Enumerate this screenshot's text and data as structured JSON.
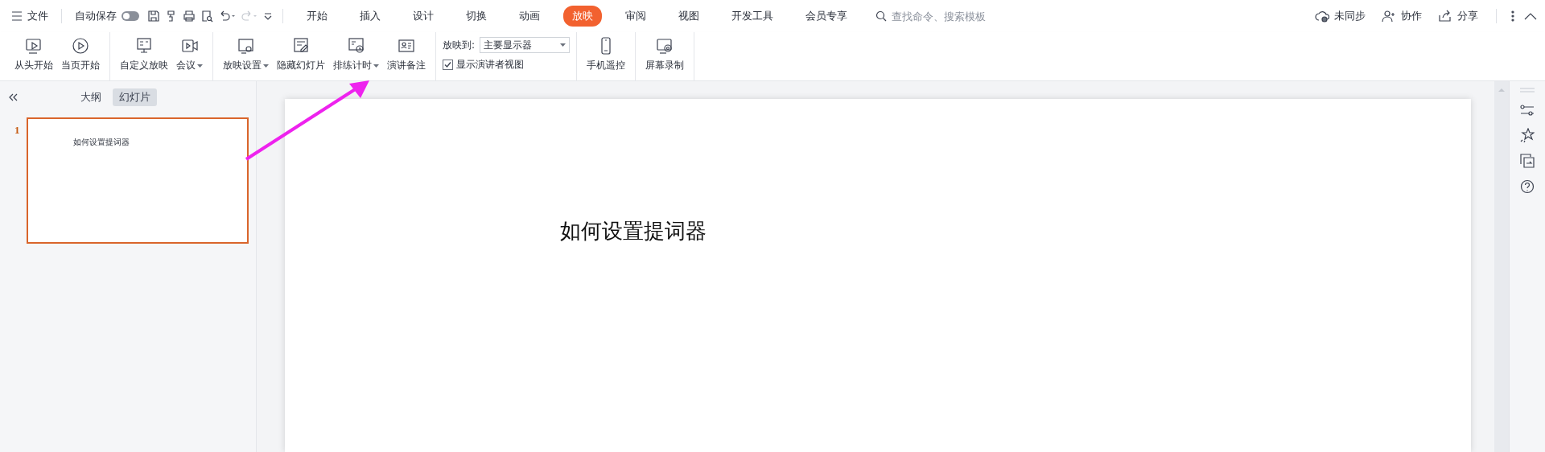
{
  "menu": {
    "label": "文件"
  },
  "autosave": {
    "label": "自动保存",
    "on": false
  },
  "redo": {
    "disabled": true
  },
  "tabs": [
    {
      "label": "开始",
      "selected": false
    },
    {
      "label": "插入",
      "selected": false
    },
    {
      "label": "设计",
      "selected": false
    },
    {
      "label": "切换",
      "selected": false
    },
    {
      "label": "动画",
      "selected": false
    },
    {
      "label": "放映",
      "selected": true
    },
    {
      "label": "审阅",
      "selected": false
    },
    {
      "label": "视图",
      "selected": false
    },
    {
      "label": "开发工具",
      "selected": false
    },
    {
      "label": "会员专享",
      "selected": false
    }
  ],
  "search": {
    "placeholder": "查找命令、搜索模板"
  },
  "header_actions": [
    {
      "label": "未同步"
    },
    {
      "label": "协作"
    },
    {
      "label": "分享"
    }
  ],
  "ribbon_groups": [
    {
      "items": [
        {
          "kind": "button",
          "label": "从头开始",
          "dropdown": false
        },
        {
          "kind": "button",
          "label": "当页开始",
          "dropdown": false
        }
      ]
    },
    {
      "items": [
        {
          "kind": "button",
          "label": "自定义放映",
          "dropdown": false
        },
        {
          "kind": "button",
          "label": "会议",
          "dropdown": true
        }
      ]
    },
    {
      "items": [
        {
          "kind": "button",
          "label": "放映设置",
          "dropdown": true
        },
        {
          "kind": "button",
          "label": "隐藏幻灯片",
          "dropdown": false
        },
        {
          "kind": "button",
          "label": "排练计时",
          "dropdown": true
        },
        {
          "kind": "button",
          "label": "演讲备注",
          "dropdown": false
        }
      ]
    },
    {
      "items": [
        {
          "kind": "select",
          "label": "放映到:",
          "value": "主要显示器"
        },
        {
          "kind": "checkbox",
          "label": "显示演讲者视图",
          "checked": true
        }
      ]
    },
    {
      "items": [
        {
          "kind": "button",
          "label": "手机遥控",
          "dropdown": false
        }
      ]
    },
    {
      "items": [
        {
          "kind": "button",
          "label": "屏幕录制",
          "dropdown": false
        }
      ]
    }
  ],
  "panel_tabs": [
    {
      "label": "大纲",
      "selected": false
    },
    {
      "label": "幻灯片",
      "selected": true
    }
  ],
  "slides": [
    {
      "number": "1",
      "title": "如何设置提词器",
      "selected": true
    }
  ],
  "slide": {
    "title": "如何设置提词器"
  }
}
